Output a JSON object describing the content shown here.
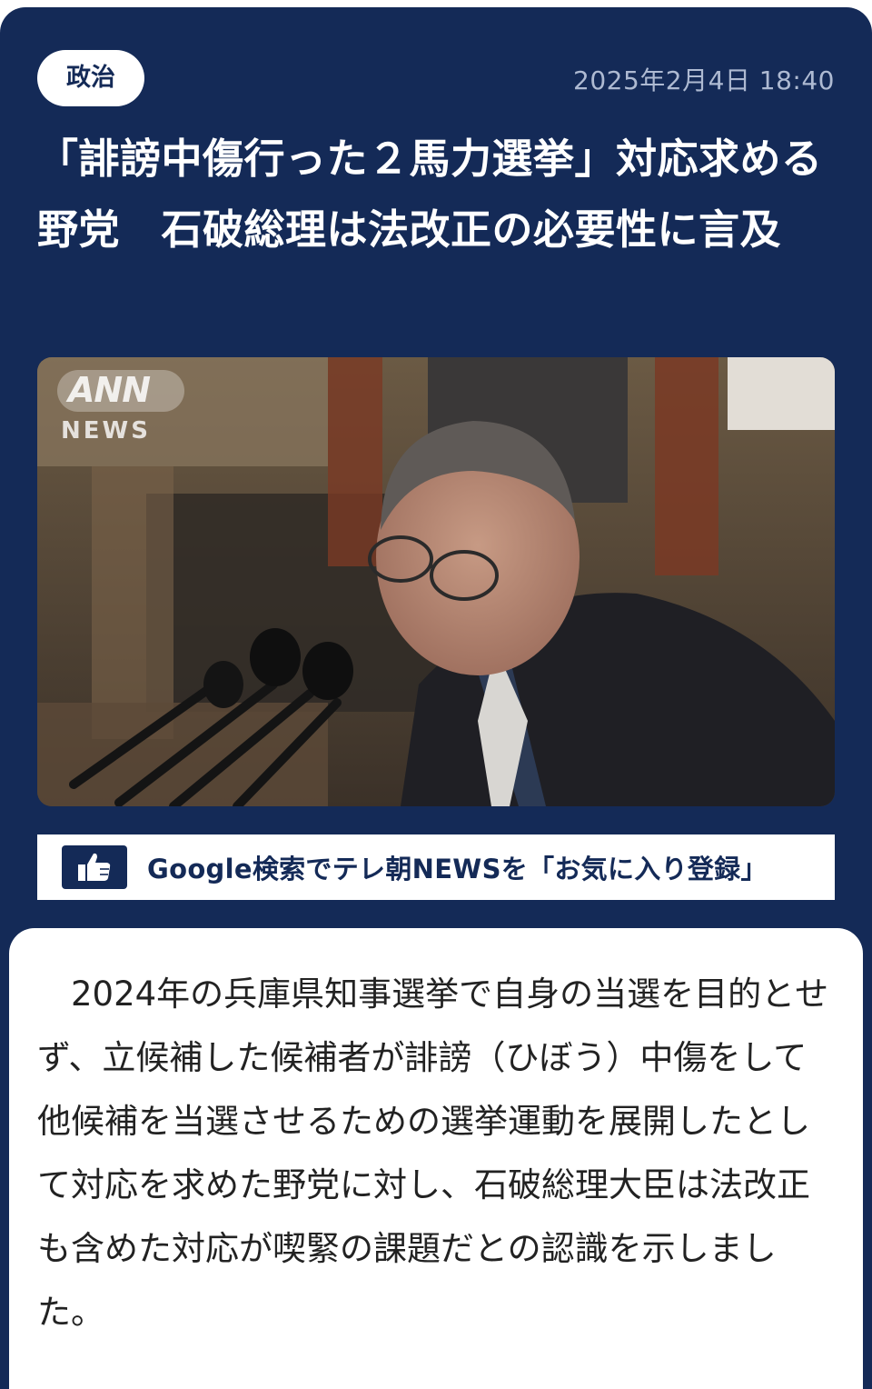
{
  "article": {
    "category": "政治",
    "published": "2025年2月4日 18:40",
    "headline": "「誹謗中傷行った２馬力選挙」対応求める野党　石破総理は法改正の必要性に言及",
    "image_watermark_top": "ANN",
    "image_watermark_bottom": "NEWS",
    "body": "2024年の兵庫県知事選挙で自身の当選を目的とせず、立候補した候補者が誹謗（ひぼう）中傷をして他候補を当選させるための選挙運動を展開したとして対応を求めた野党に対し、石破総理大臣は法改正も含めた対応が喫緊の課題だとの認識を示しました。"
  },
  "favorite_banner": {
    "icon": "thumbs-up-icon",
    "label": "Google検索でテレ朝NEWSを「お気に入り登録」"
  },
  "colors": {
    "navy": "#142a57",
    "white": "#ffffff",
    "timestamp": "#aebad2",
    "body_text": "#222222"
  }
}
